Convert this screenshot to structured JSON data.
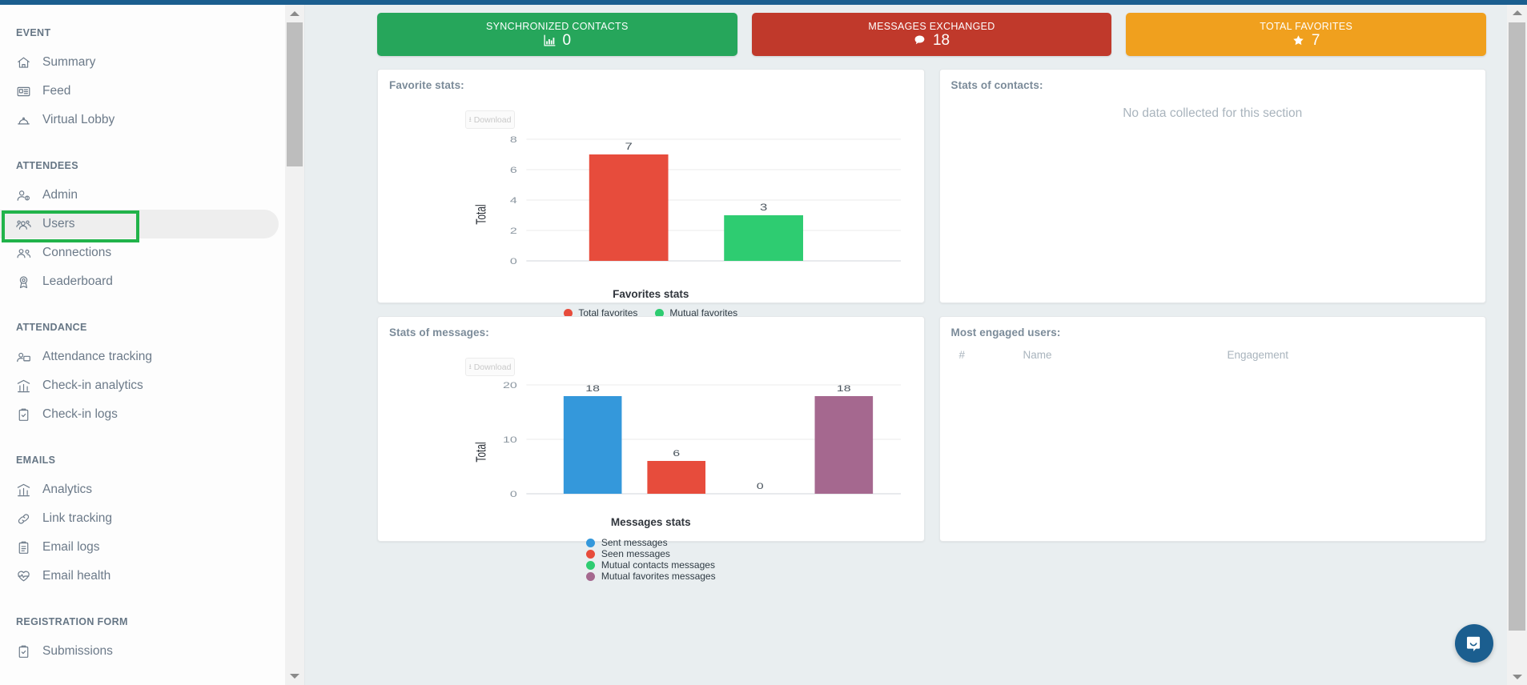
{
  "theme": {
    "topbar_color": "#1b5e8f",
    "content_bg": "#e9eef0",
    "highlight_color": "#21b34a"
  },
  "sidebar": {
    "groups": [
      {
        "title": "EVENT",
        "items": [
          {
            "label": "Summary",
            "icon": "home-icon"
          },
          {
            "label": "Feed",
            "icon": "feed-card-icon"
          },
          {
            "label": "Virtual Lobby",
            "icon": "bell-dome-icon"
          }
        ]
      },
      {
        "title": "ATTENDEES",
        "items": [
          {
            "label": "Admin",
            "icon": "user-admin-icon"
          },
          {
            "label": "Users",
            "icon": "users-group-icon",
            "state": "hovered-selected"
          },
          {
            "label": "Connections",
            "icon": "connections-icon"
          },
          {
            "label": "Leaderboard",
            "icon": "medal-icon"
          }
        ]
      },
      {
        "title": "ATTENDANCE",
        "items": [
          {
            "label": "Attendance tracking",
            "icon": "attendance-icon"
          },
          {
            "label": "Check-in analytics",
            "icon": "bar-chart-icon"
          },
          {
            "label": "Check-in logs",
            "icon": "clipboard-check-icon"
          }
        ]
      },
      {
        "title": "EMAILS",
        "items": [
          {
            "label": "Analytics",
            "icon": "bar-chart-icon"
          },
          {
            "label": "Link tracking",
            "icon": "link-icon"
          },
          {
            "label": "Email logs",
            "icon": "clipboard-list-icon"
          },
          {
            "label": "Email health",
            "icon": "heart-pulse-icon"
          }
        ]
      },
      {
        "title": "REGISTRATION FORM",
        "items": [
          {
            "label": "Submissions",
            "icon": "clipboard-check-icon"
          }
        ]
      }
    ]
  },
  "stat_cards": [
    {
      "title": "SYNCHRONIZED CONTACTS",
      "value": "0",
      "icon": "bar-chart-icon",
      "color": "#26a65b"
    },
    {
      "title": "MESSAGES EXCHANGED",
      "value": "18",
      "icon": "chat-bubble-icon",
      "color": "#c0392b"
    },
    {
      "title": "TOTAL FAVORITES",
      "value": "7",
      "icon": "star-icon",
      "color": "#f0a01e"
    }
  ],
  "panels": {
    "favorite_stats": {
      "title": "Favorite stats:",
      "download_label": "Download",
      "download_icon": "download-icon"
    },
    "stats_of_contacts": {
      "title": "Stats of contacts:",
      "empty_message": "No data collected for this section"
    },
    "stats_of_messages": {
      "title": "Stats of messages:",
      "download_label": "Download",
      "download_icon": "download-icon"
    },
    "most_engaged_users": {
      "title": "Most engaged users:",
      "columns": [
        "#",
        "Name",
        "Engagement"
      ],
      "rows": []
    }
  },
  "chart_data": [
    {
      "id": "favorites",
      "type": "bar",
      "title": "Favorites stats",
      "xlabel": "Favorites stats",
      "ylabel": "Total",
      "categories": [
        "Total favorites",
        "Mutual favorites"
      ],
      "values": [
        7,
        3
      ],
      "colors": [
        "#e74c3c",
        "#2ecc71"
      ],
      "ylim": [
        0,
        8
      ],
      "yticks": [
        0,
        2,
        4,
        6,
        8
      ],
      "grid": true,
      "legend_position": "bottom",
      "legend": [
        "Total favorites",
        "Mutual favorites"
      ],
      "data_labels": [
        "7",
        "3"
      ]
    },
    {
      "id": "messages",
      "type": "bar",
      "title": "Messages stats",
      "xlabel": "Messages stats",
      "ylabel": "Total",
      "categories": [
        "Sent messages",
        "Seen messages",
        "Mutual contacts messages",
        "Mutual favorites messages"
      ],
      "values": [
        18,
        6,
        0,
        18
      ],
      "colors": [
        "#3498db",
        "#e74c3c",
        "#2ecc71",
        "#a5688f"
      ],
      "ylim": [
        0,
        20
      ],
      "yticks": [
        0,
        10,
        20
      ],
      "grid": true,
      "legend_position": "bottom",
      "legend": [
        "Sent messages",
        "Seen messages",
        "Mutual contacts messages",
        "Mutual favorites messages"
      ],
      "data_labels": [
        "18",
        "6",
        "0",
        "18"
      ]
    }
  ],
  "chat_widget": {
    "icon": "intercom-chat-icon"
  }
}
